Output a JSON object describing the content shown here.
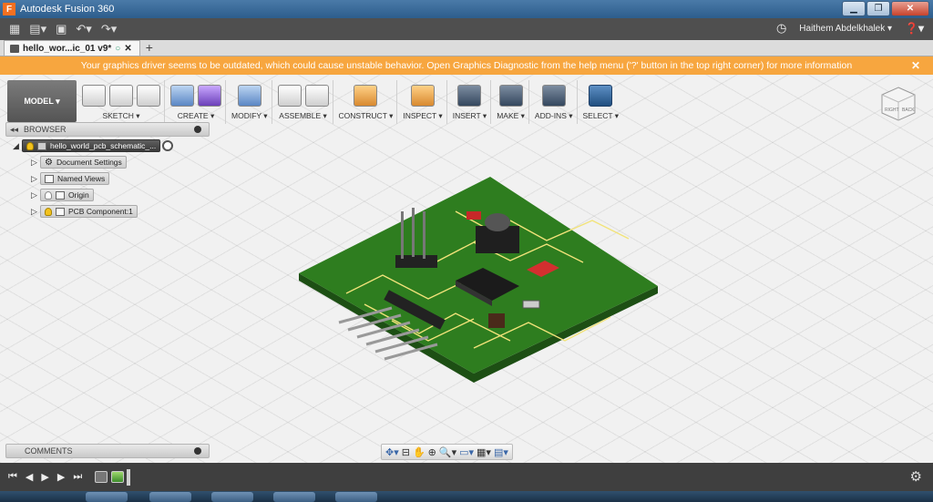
{
  "window": {
    "title": "Autodesk Fusion 360",
    "logo": "F"
  },
  "appbar": {
    "user": "Haithem Abdelkhalek ▾"
  },
  "tab": {
    "name": "hello_wor...ic_01 v9*",
    "close": "✕",
    "new": "+"
  },
  "warning": {
    "text": "Your graphics driver seems to be outdated, which could cause unstable behavior. Open Graphics Diagnostic from the help menu ('?' button in the top right corner) for more information",
    "close": "✕"
  },
  "toolbar": {
    "workspace": "MODEL ▾",
    "groups": [
      {
        "label": "SKETCH ▾"
      },
      {
        "label": "CREATE ▾"
      },
      {
        "label": "MODIFY ▾"
      },
      {
        "label": "ASSEMBLE ▾"
      },
      {
        "label": "CONSTRUCT ▾"
      },
      {
        "label": "INSPECT ▾"
      },
      {
        "label": "INSERT ▾"
      },
      {
        "label": "MAKE ▾"
      },
      {
        "label": "ADD-INS ▾"
      },
      {
        "label": "SELECT ▾"
      }
    ]
  },
  "viewcube": {
    "right": "RIGHT",
    "back": "BACK"
  },
  "browser": {
    "title": "BROWSER",
    "root": "hello_world_pcb_schematic_...",
    "items": [
      {
        "label": "Document Settings"
      },
      {
        "label": "Named Views"
      },
      {
        "label": "Origin"
      },
      {
        "label": "PCB Component:1"
      }
    ]
  },
  "comments": {
    "title": "COMMENTS"
  },
  "colors": {
    "warning": "#f7a63f",
    "board": "#2e7d1f",
    "trace": "#f2e37a",
    "accent": "#f37021"
  }
}
